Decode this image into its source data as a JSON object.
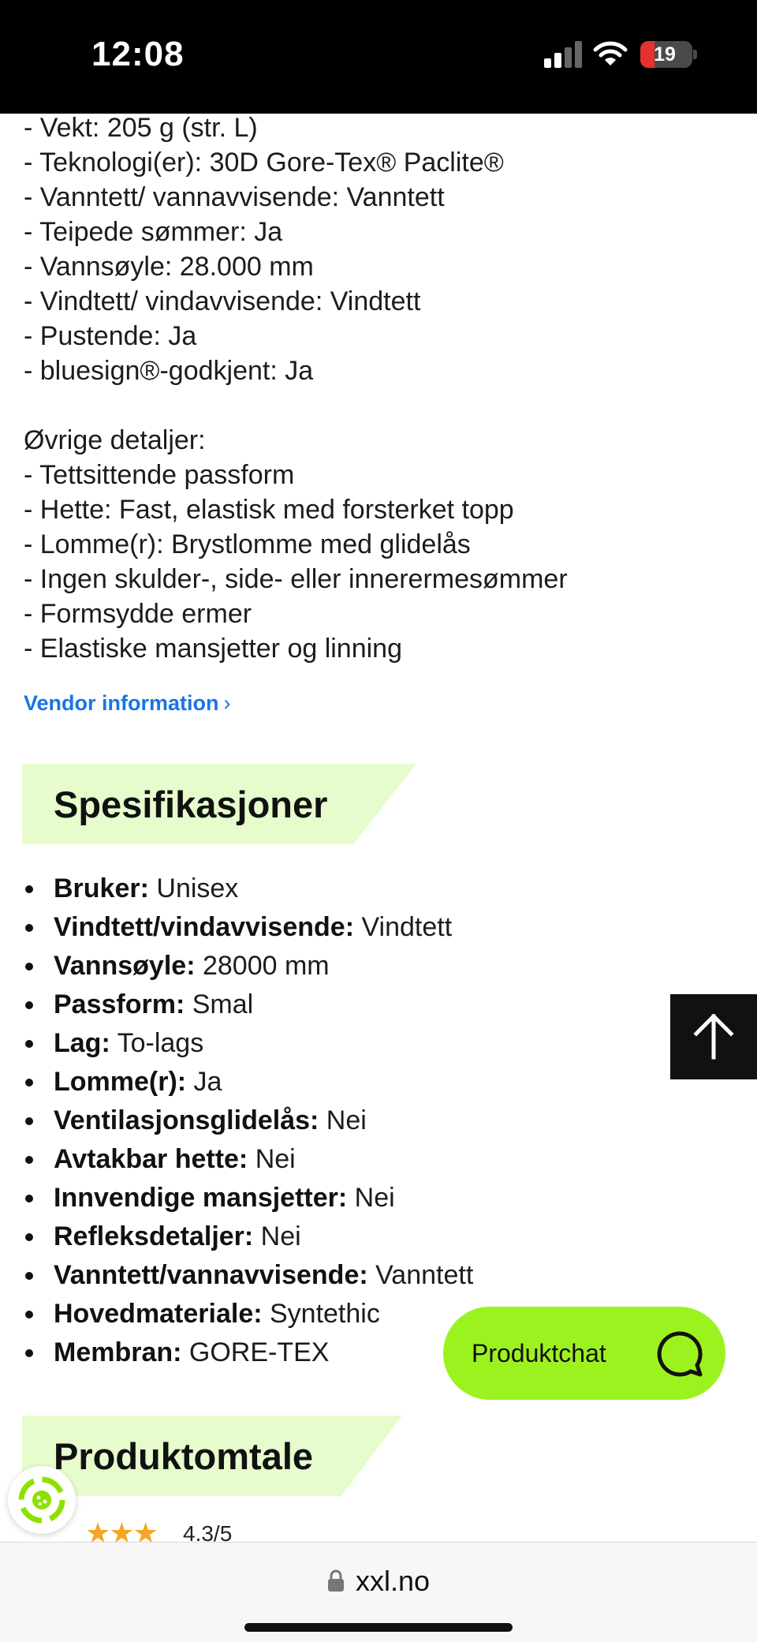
{
  "status_bar": {
    "time": "12:08",
    "battery": "19"
  },
  "details": {
    "lines_top": [
      "- Vekt: 205 g (str. L)",
      "- Teknologi(er): 30D Gore-Tex® Paclite®",
      "- Vanntett/ vannavvisende: Vanntett",
      "- Teipede sømmer: Ja",
      "- Vannsøyle: 28.000 mm",
      "- Vindtett/ vindavvisende: Vindtett",
      "- Pustende: Ja",
      "- bluesign®-godkjent: Ja"
    ],
    "other_heading": "Øvrige detaljer:",
    "lines_other": [
      "- Tettsittende passform",
      "- Hette: Fast, elastisk med forsterket topp",
      "- Lomme(r): Brystlomme med glidelås",
      "- Ingen skulder-, side- eller innerermesømmer",
      "- Formsydde ermer",
      "- Elastiske mansjetter og linning"
    ]
  },
  "vendor_link": {
    "label": "Vendor information",
    "chevron": "›"
  },
  "specs": {
    "title": "Spesifikasjoner",
    "items": [
      {
        "key": "Bruker:",
        "value": " Unisex"
      },
      {
        "key": "Vindtett/vindavvisende:",
        "value": " Vindtett"
      },
      {
        "key": "Vannsøyle:",
        "value": " 28000 mm"
      },
      {
        "key": "Passform:",
        "value": " Smal"
      },
      {
        "key": "Lag:",
        "value": " To-lags"
      },
      {
        "key": "Lomme(r):",
        "value": " Ja"
      },
      {
        "key": "Ventilasjonsglidelås:",
        "value": " Nei"
      },
      {
        "key": "Avtakbar hette:",
        "value": " Nei"
      },
      {
        "key": "Innvendige mansjetter:",
        "value": " Nei"
      },
      {
        "key": "Refleksdetaljer:",
        "value": " Nei"
      },
      {
        "key": "Vanntett/vannavvisende:",
        "value": " Vanntett"
      },
      {
        "key": "Hovedmateriale:",
        "value": " Syntethic"
      },
      {
        "key": "Membran:",
        "value": " GORE-TEX"
      }
    ]
  },
  "reviews": {
    "title": "Produktomtale",
    "rating_text": "4.3/5",
    "stars": "★★★",
    "rating": 4.3
  },
  "chat": {
    "label": "Produktchat"
  },
  "browser": {
    "url": "xxl.no"
  },
  "colors": {
    "accent_green": "#9cf21f",
    "section_bg": "#e6fccd",
    "link_blue": "#1a73e8"
  },
  "icons": [
    "signal-icon",
    "wifi-icon",
    "battery-icon",
    "chevron-right-icon",
    "arrow-up-icon",
    "chat-bubble-icon",
    "cookie-icon",
    "lock-icon"
  ]
}
